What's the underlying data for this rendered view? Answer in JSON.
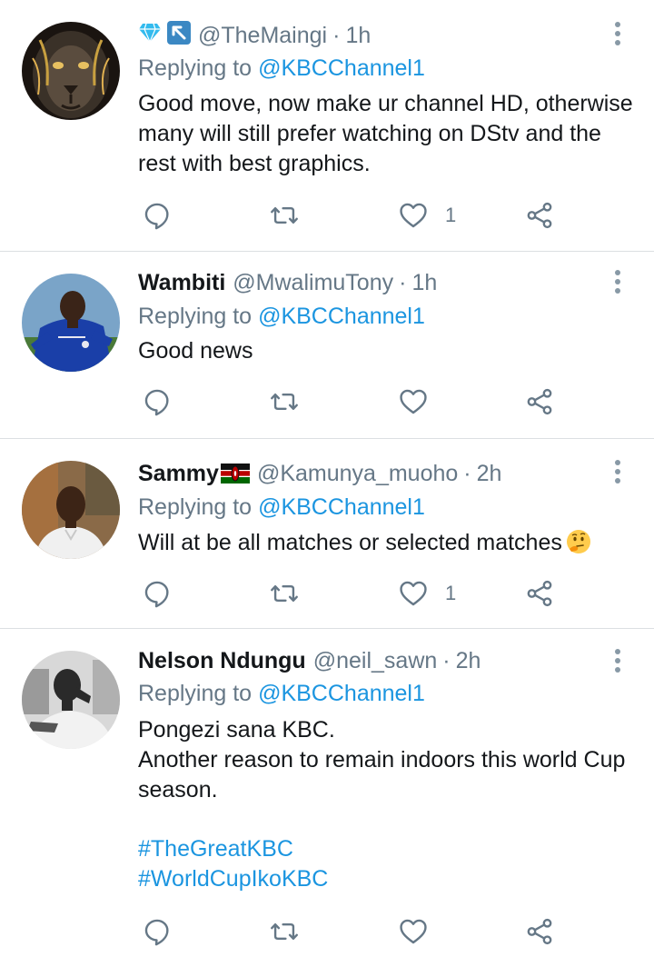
{
  "tweets": [
    {
      "name": "",
      "handle": "@TheMaingi",
      "time": "1h",
      "replying_label": "Replying to",
      "replying_to": "@KBCChannel1",
      "text_lines": [
        "Good move, now make ur channel HD, otherwise",
        "many will still prefer watching on DStv and the",
        "rest with best graphics."
      ],
      "hashtags": [],
      "likes": "1",
      "badges": [
        "diamond-emoji",
        "arrow-up-left-emoji"
      ]
    },
    {
      "name": "Wambiti",
      "handle": "@MwalimuTony",
      "time": "1h",
      "replying_label": "Replying to",
      "replying_to": "@KBCChannel1",
      "text_lines": [
        "Good news"
      ],
      "hashtags": [],
      "likes": ""
    },
    {
      "name": "Sammy",
      "handle": "@Kamunya_muoho",
      "time": "2h",
      "replying_label": "Replying to",
      "replying_to": "@KBCChannel1",
      "text_lines": [
        "Will at be all matches or selected matches"
      ],
      "hashtags": [],
      "likes": "1",
      "name_emoji": "kenya-flag-emoji",
      "text_emoji": "thinking-face-emoji"
    },
    {
      "name": "Nelson Ndungu",
      "handle": "@neil_sawn",
      "time": "2h",
      "replying_label": "Replying to",
      "replying_to": "@KBCChannel1",
      "text_lines": [
        "Pongezi sana KBC.",
        "Another reason to remain indoors this world Cup",
        "season."
      ],
      "hashtags": [
        "#TheGreatKBC",
        "#WorldCupIkoKBC"
      ],
      "likes": ""
    }
  ],
  "separator": "·",
  "colors": {
    "link": "#1b95e0",
    "secondary_text": "#657786",
    "icon": "#657786",
    "divider": "#dcdfe2"
  }
}
